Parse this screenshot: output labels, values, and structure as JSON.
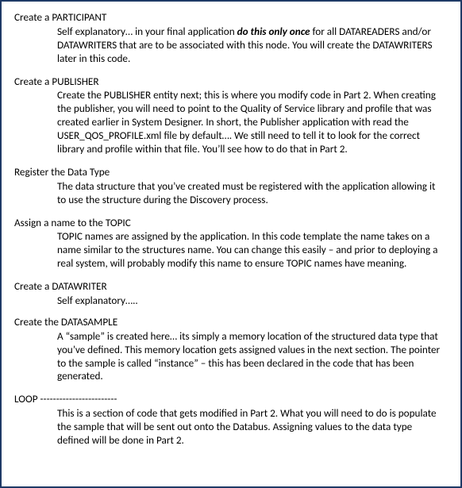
{
  "sections": [
    {
      "heading": "Create a PARTICIPANT",
      "body_pre": "Self explanatory…  in your final application ",
      "body_emph": "do this only once",
      "body_post": " for all DATAREADERS and/or DATAWRITERS that are to be associated with this node.  You will create the DATAWRITERS later in this code."
    },
    {
      "heading": "Create a PUBLISHER",
      "body": "Create the PUBLISHER entity next;  this is where you modify code in Part 2. When creating the publisher, you will need to point to the Quality of Service library and profile that was created earlier in System Designer.  In short,  the Publisher application with read the USER_QOS_PROFILE.xml file by default…. We still need to tell it to look for the correct library and profile within that file. You’ll see how to do that in Part 2."
    },
    {
      "heading": "Register the Data Type",
      "body": "The data structure that you’ve created must be registered with the application allowing it to use the structure during the Discovery process."
    },
    {
      "heading": "Assign a name to the TOPIC",
      "body": "TOPIC names are assigned  by the application. In this code template the name takes on a name similar to the structures name.  You can change this easily – and prior to deploying a real system,  will probably modify this name to ensure TOPIC names have meaning."
    },
    {
      "heading": "Create a DATAWRITER",
      "body": "Self explanatory….."
    },
    {
      "heading": "Create the DATASAMPLE",
      "body": "A “sample” is created here… its simply a memory location of the structured data type that you’ve defined.  This memory location gets assigned values in the next section.  The pointer to the sample is called “instance” – this has been declared in the code that has been generated."
    },
    {
      "heading": "LOOP ------------------------",
      "body": "This is a section of code that gets modified in Part 2.  What you will need to do is populate the sample that will be sent out onto the Databus.  Assigning values to the data type defined will be done in Part 2."
    }
  ]
}
